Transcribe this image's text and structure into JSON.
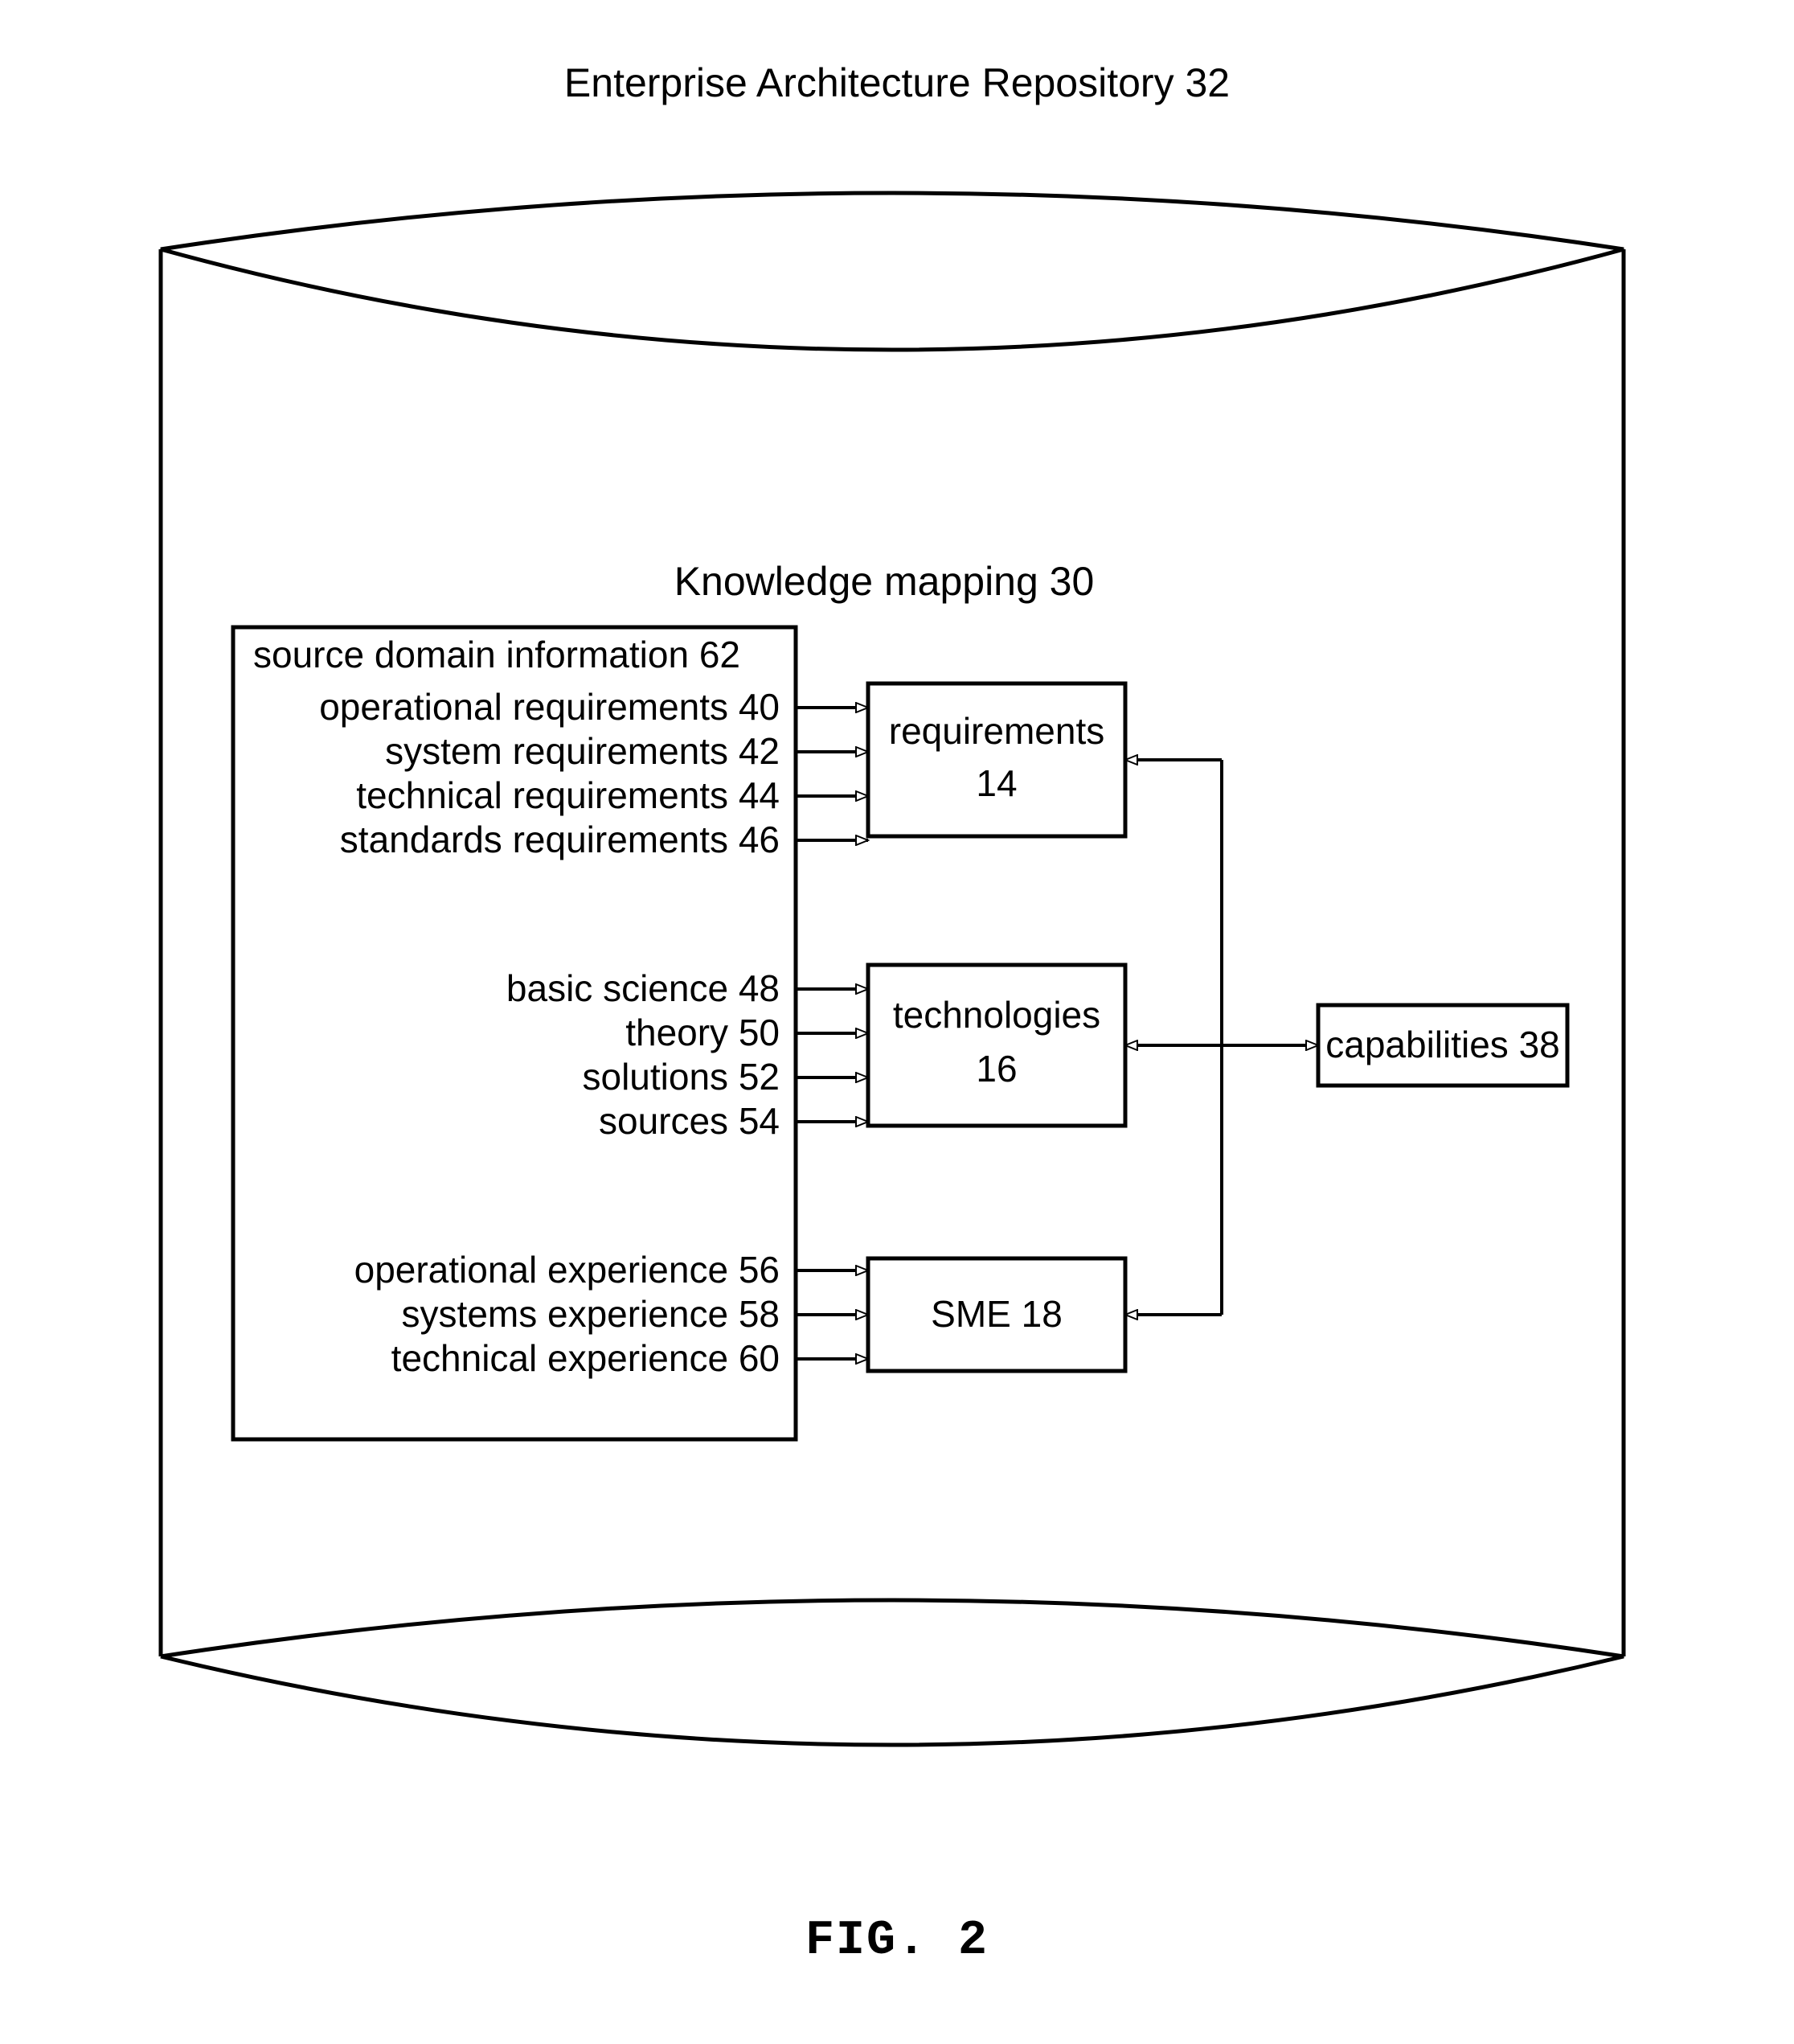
{
  "title": "Enterprise Architecture Repository 32",
  "section_title": "Knowledge mapping 30",
  "source_domain": {
    "heading": "source domain information 62",
    "reqs": [
      "operational requirements 40",
      "system  requirements 42",
      "technical requirements 44",
      "standards requirements 46"
    ],
    "tech": [
      "basic science 48",
      "theory 50",
      "solutions 52",
      "sources 54"
    ],
    "sme": [
      "operational experience 56",
      "systems experience 58",
      "technical experience 60"
    ]
  },
  "boxes": {
    "requirements": {
      "line1": "requirements",
      "line2": "14"
    },
    "technologies": {
      "line1": "technologies",
      "line2": "16"
    },
    "sme": {
      "line1": "SME 18"
    },
    "capabilities": {
      "line1": "capabilities 38"
    }
  },
  "figure_caption": "FIG. 2"
}
